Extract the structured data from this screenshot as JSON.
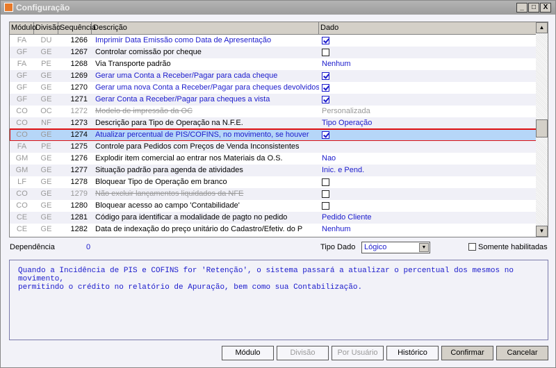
{
  "window": {
    "title": "Configuração",
    "buttons": [
      "_",
      "□",
      "X"
    ]
  },
  "grid": {
    "columns": [
      "Módulo",
      "Divisão",
      "Sequência",
      "Descrição",
      "Dado"
    ],
    "rows": [
      {
        "modulo": "FA",
        "divisao": "DU",
        "seq": "1266",
        "desc": "Imprimir Data Emissão como Data de Apresentação",
        "style": "blue",
        "dado_type": "check",
        "dado": true
      },
      {
        "modulo": "GF",
        "divisao": "GE",
        "seq": "1267",
        "desc": "Controlar comissão por cheque",
        "style": "black",
        "dado_type": "check",
        "dado": false
      },
      {
        "modulo": "FA",
        "divisao": "PE",
        "seq": "1268",
        "desc": "Via Transporte padrão",
        "style": "black",
        "dado_type": "text",
        "dado": "Nenhum"
      },
      {
        "modulo": "GF",
        "divisao": "GE",
        "seq": "1269",
        "desc": "Gerar uma Conta a Receber/Pagar para cada cheque",
        "style": "blue",
        "dado_type": "check",
        "dado": true
      },
      {
        "modulo": "GF",
        "divisao": "GE",
        "seq": "1270",
        "desc": "Gerar uma nova Conta a Receber/Pagar para cheques devolvidos",
        "style": "blue",
        "dado_type": "check",
        "dado": true
      },
      {
        "modulo": "GF",
        "divisao": "GE",
        "seq": "1271",
        "desc": "Gerar Conta a Receber/Pagar para cheques a vista",
        "style": "blue",
        "dado_type": "check",
        "dado": true
      },
      {
        "modulo": "CO",
        "divisao": "OC",
        "seq": "1272",
        "desc": "Modelo de impressão da OC",
        "style": "strike",
        "dado_type": "text",
        "dado": "Personalizada"
      },
      {
        "modulo": "CO",
        "divisao": "NF",
        "seq": "1273",
        "desc": "Descrição para Tipo de Operação na N.F.E.",
        "style": "black",
        "dado_type": "text",
        "dado": "Tipo Operação"
      },
      {
        "modulo": "CO",
        "divisao": "GE",
        "seq": "1274",
        "desc": "Atualizar percentual de PIS/COFINS, no movimento, se houver",
        "style": "blue",
        "dado_type": "check",
        "dado": true,
        "selected": true
      },
      {
        "modulo": "FA",
        "divisao": "PE",
        "seq": "1275",
        "desc": "Controle para Pedidos com Preços de Venda Inconsistentes",
        "style": "black",
        "dado_type": "text",
        "dado": ""
      },
      {
        "modulo": "GM",
        "divisao": "GE",
        "seq": "1276",
        "desc": "Explodir item comercial ao entrar nos Materiais da O.S.",
        "style": "black",
        "dado_type": "text",
        "dado": "Nao"
      },
      {
        "modulo": "GM",
        "divisao": "GE",
        "seq": "1277",
        "desc": "Situação padrão para agenda de atividades",
        "style": "black",
        "dado_type": "text",
        "dado": "Inic. e Pend."
      },
      {
        "modulo": "LF",
        "divisao": "GE",
        "seq": "1278",
        "desc": "Bloquear Tipo de Operação em branco",
        "style": "black",
        "dado_type": "check",
        "dado": false
      },
      {
        "modulo": "CO",
        "divisao": "GE",
        "seq": "1279",
        "desc": "Não excluir lançamentos liquidados da NFE",
        "style": "strike",
        "dado_type": "check",
        "dado": false
      },
      {
        "modulo": "CO",
        "divisao": "GE",
        "seq": "1280",
        "desc": "Bloquear acesso ao campo 'Contabilidade'",
        "style": "black",
        "dado_type": "check",
        "dado": false
      },
      {
        "modulo": "CE",
        "divisao": "GE",
        "seq": "1281",
        "desc": "Código para identificar a modalidade de pagto no pedido",
        "style": "black",
        "dado_type": "text",
        "dado": "Pedido Cliente"
      },
      {
        "modulo": "CE",
        "divisao": "GE",
        "seq": "1282",
        "desc": "Data de indexação do preço unitário do Cadastro/Efetiv. do P",
        "style": "black",
        "dado_type": "text",
        "dado": "Nenhum"
      }
    ]
  },
  "footer": {
    "dependencia_label": "Dependência",
    "dependencia_value": "0",
    "tipo_dado_label": "Tipo Dado",
    "tipo_dado_value": "Lógico",
    "somente_label": "Somente habilitadas",
    "memo": "Quando a Incidência de PIS e COFINS for 'Retenção', o sistema passará a atualizar o percentual dos mesmos no movimento,\npermitindo o crédito no relatório de Apuração, bem como sua Contabilização."
  },
  "buttons": {
    "modulo": "Módulo",
    "divisao": "Divisão",
    "por_usuario": "Por Usuário",
    "historico": "Histórico",
    "confirmar": "Confirmar",
    "cancelar": "Cancelar"
  }
}
